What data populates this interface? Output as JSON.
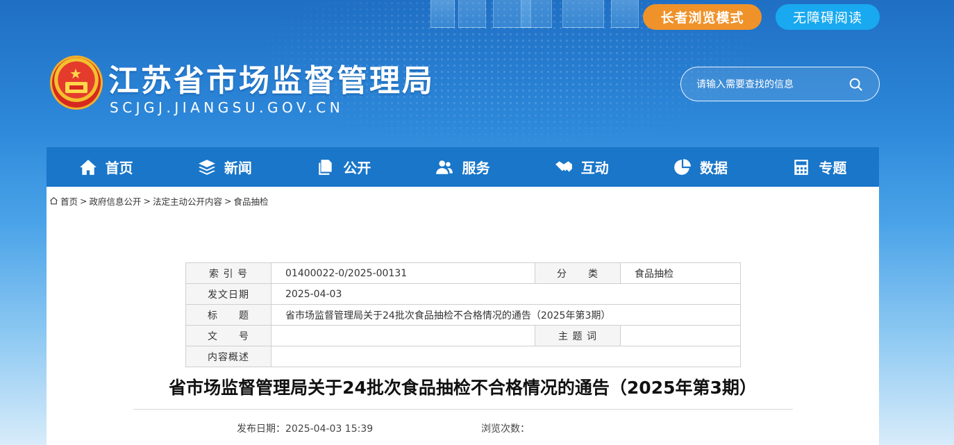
{
  "header": {
    "elder_mode_label": "长者浏览模式",
    "accessible_label": "无障碍阅读",
    "site_title": "江苏省市场监督管理局",
    "site_domain": "SCJGJ.JIANGSU.GOV.CN",
    "search_placeholder": "请输入需要查找的信息"
  },
  "nav": {
    "items": [
      {
        "label": "首页",
        "icon": "home-icon"
      },
      {
        "label": "新闻",
        "icon": "layers-icon"
      },
      {
        "label": "公开",
        "icon": "document-stack-icon"
      },
      {
        "label": "服务",
        "icon": "users-icon"
      },
      {
        "label": "互动",
        "icon": "handshake-icon"
      },
      {
        "label": "数据",
        "icon": "pie-chart-icon"
      },
      {
        "label": "专题",
        "icon": "calculator-icon"
      }
    ]
  },
  "breadcrumb": {
    "items": [
      "首页",
      "政府信息公开",
      "法定主动公开内容",
      "食品抽检"
    ],
    "separator": ">"
  },
  "meta_table": {
    "index_label": "索 引 号",
    "index_value": "01400022-0/2025-00131",
    "category_label": "分　　类",
    "category_value": "食品抽检",
    "date_label": "发文日期",
    "date_value": "2025-04-03",
    "title_label": "标　　题",
    "title_value": "省市场监督管理局关于24批次食品抽检不合格情况的通告（2025年第3期）",
    "doc_no_label": "文　　号",
    "doc_no_value": "",
    "keywords_label": "主 题 词",
    "keywords_value": "",
    "summary_label": "内容概述",
    "summary_value": ""
  },
  "article": {
    "title": "省市场监督管理局关于24批次食品抽检不合格情况的通告（2025年第3期）",
    "publish_label": "发布日期：2025-04-03 15:39",
    "views_label": "浏览次数："
  },
  "colors": {
    "nav_bg": "#1976c9",
    "elder_btn": "#f0922a",
    "accessible_btn": "#19a9f0"
  }
}
